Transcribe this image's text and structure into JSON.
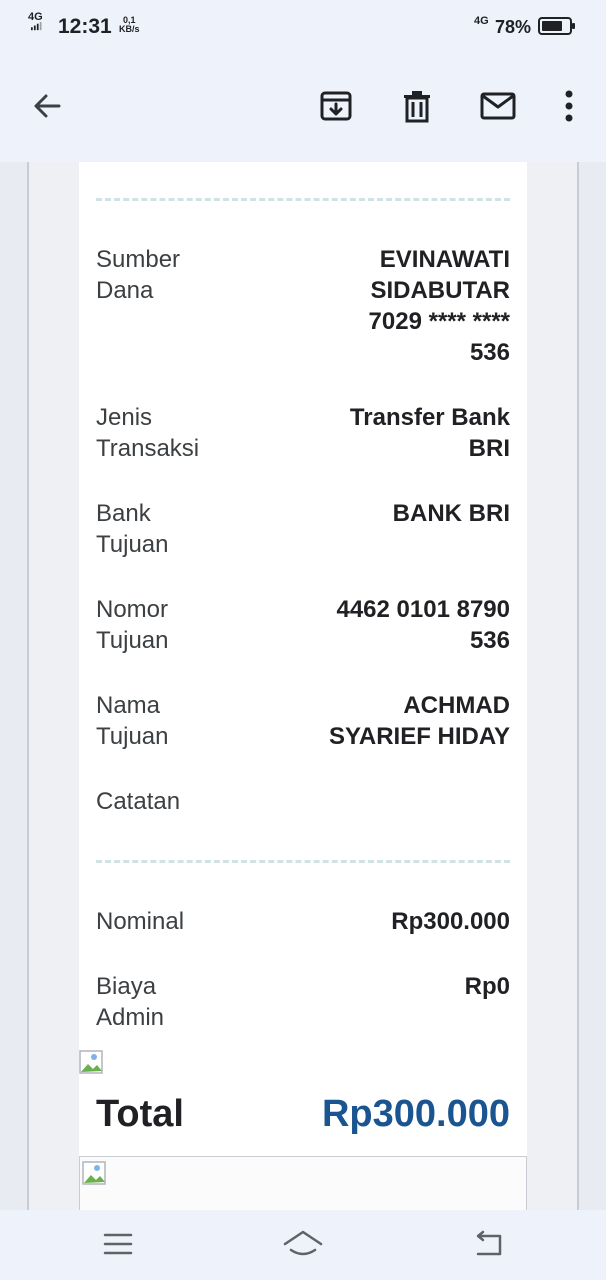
{
  "status_bar": {
    "network_left": "4G",
    "time": "12:31",
    "speed_value": "0,1",
    "speed_unit": "KB/s",
    "network_right": "4G",
    "battery_percent": "78%"
  },
  "toolbar": {
    "icons": [
      "back-arrow-icon",
      "archive-icon",
      "delete-icon",
      "mail-icon",
      "more-vert-icon"
    ]
  },
  "receipt": {
    "rows": [
      {
        "label_1": "Sumber",
        "label_2": "Dana",
        "value_lines": [
          "EVINAWATI",
          "SIDABUTAR",
          "7029 **** ****",
          "536"
        ]
      },
      {
        "label_1": "Jenis",
        "label_2": "Transaksi",
        "value_lines": [
          "Transfer Bank",
          "BRI"
        ]
      },
      {
        "label_1": "Bank",
        "label_2": "Tujuan",
        "value_lines": [
          "BANK BRI"
        ]
      },
      {
        "label_1": "Nomor",
        "label_2": "Tujuan",
        "value_lines": [
          "4462 0101 8790",
          "536"
        ]
      },
      {
        "label_1": "Nama",
        "label_2": "Tujuan",
        "value_lines": [
          "ACHMAD",
          "SYARIEF HIDAY"
        ]
      },
      {
        "label_1": "Catatan",
        "label_2": "",
        "value_lines": []
      }
    ],
    "amounts": [
      {
        "label_1": "Nominal",
        "label_2": "",
        "value": "Rp300.000"
      },
      {
        "label_1": "Biaya",
        "label_2": "Admin",
        "value": "Rp0"
      }
    ],
    "total_label": "Total",
    "total_value": "Rp300.000",
    "total_color": "#1a5591"
  },
  "nav_bar": {
    "icons": [
      "menu-icon",
      "home-icon",
      "back-icon"
    ]
  }
}
